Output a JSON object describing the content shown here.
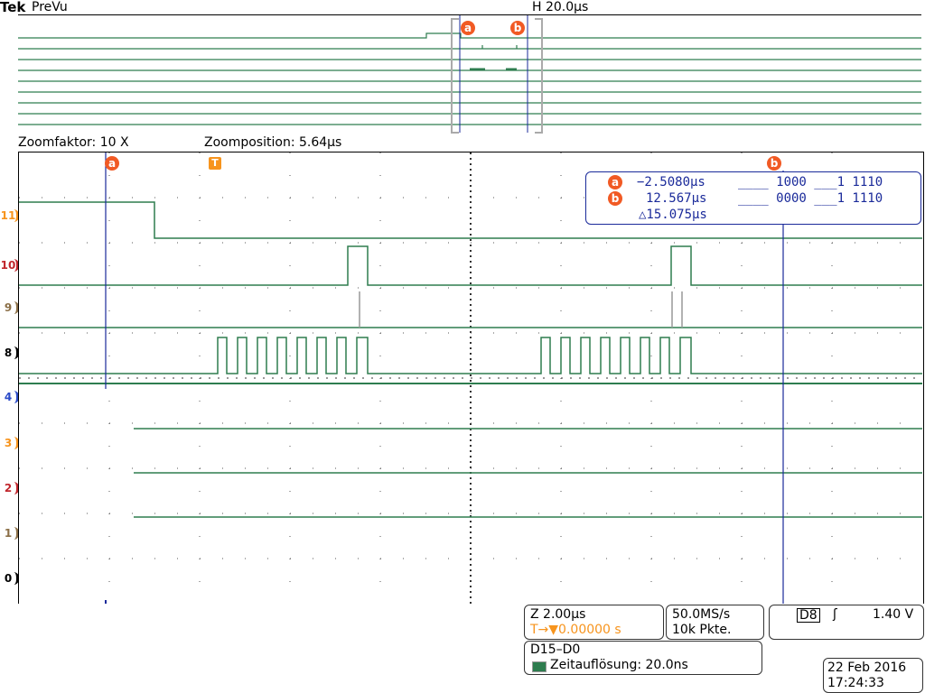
{
  "header": {
    "brand": "Tek",
    "mode": "PreVu",
    "horizontal": "H 20.0µs"
  },
  "zoom_bar": {
    "factor": "Zoomfaktor: 10 X",
    "position": "Zoomposition: 5.64µs"
  },
  "cursors": {
    "a_label": "a",
    "b_label": "b",
    "trigger_label": "T",
    "a_time": "−2.5080µs",
    "a_bits": "____ 1000 ___1 1110",
    "b_time": "12.567µs",
    "b_bits": "____ 0000 ___1 1110",
    "delta": "△15.075µs"
  },
  "channels": [
    "11",
    "10",
    "9",
    "8",
    "4",
    "3",
    "2",
    "1",
    "0"
  ],
  "colors": {
    "trace": "#2e7d4f",
    "cursor": "#1a2a9a",
    "grid": "#555555",
    "badge": "#f15a24",
    "trigger": "#f7941d"
  },
  "status": {
    "zoom_scale": "Z 2.00µs",
    "trigger_pos": "T→▼0.00000 s",
    "sample_rate": "50.0MS/s",
    "record_length": "10k Pkte.",
    "trigger_source": "D8",
    "trigger_slope": "ʃ",
    "trigger_level": "1.40 V",
    "bus": "D15–D0",
    "resolution": "Zeitauflösung: 20.0ns",
    "date": "22 Feb  2016",
    "time": "17:24:33"
  }
}
